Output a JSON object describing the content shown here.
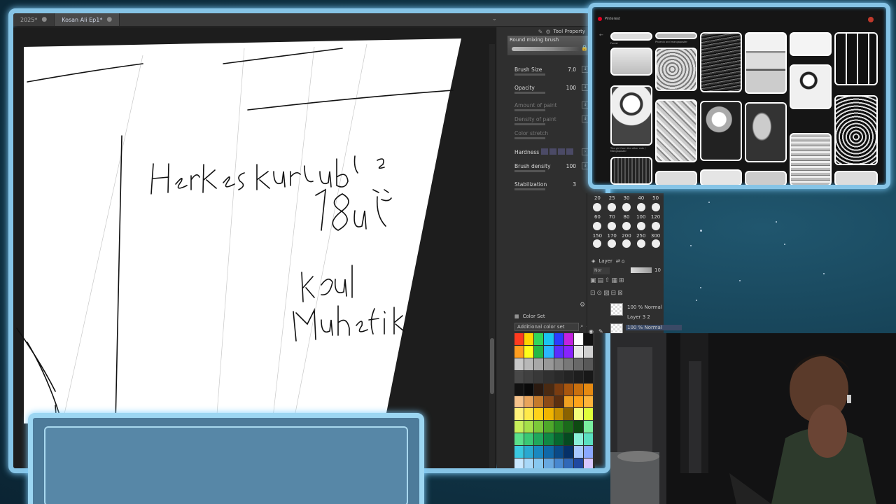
{
  "document_tabs": [
    {
      "label": "2025*",
      "active": false
    },
    {
      "label": "Kosan Ali Ep1*",
      "active": true
    }
  ],
  "tool_property": {
    "header": "Tool Property",
    "brush_name": "Round mixing brush",
    "properties": [
      {
        "label": "Brush Size",
        "value": "7.0",
        "enabled": true
      },
      {
        "label": "Opacity",
        "value": "100",
        "enabled": true
      },
      {
        "label": "Amount of paint",
        "value": "",
        "enabled": false
      },
      {
        "label": "Density of paint",
        "value": "",
        "enabled": false
      },
      {
        "label": "Color stretch",
        "value": "",
        "enabled": false
      },
      {
        "label": "Hardness",
        "value": "",
        "enabled": true
      },
      {
        "label": "Brush density",
        "value": "100",
        "enabled": true
      },
      {
        "label": "Stabilization",
        "value": "3",
        "enabled": true
      }
    ]
  },
  "color_set": {
    "header": "Color Set",
    "selected": "Additional color set",
    "colors": [
      "#ff3b1f",
      "#ffd400",
      "#2fd65c",
      "#19c4f0",
      "#2a3cff",
      "#c322e0",
      "#ffffff",
      "#111111",
      "#ff9e1f",
      "#ffff1a",
      "#23b847",
      "#2ab6ff",
      "#5a2dff",
      "#8822ff",
      "#e8e8e8",
      "#d0d0d0",
      "#c8c8c8",
      "#b8b8b8",
      "#a8a8a8",
      "#989898",
      "#888888",
      "#787878",
      "#686868",
      "#585858",
      "#484848",
      "#404040",
      "#383838",
      "#303030",
      "#2a2a2a",
      "#242424",
      "#1e1e1e",
      "#181818",
      "#111111",
      "#0a0a0a",
      "#2b1a10",
      "#4a2a12",
      "#7a3c10",
      "#a8560e",
      "#c9700e",
      "#e68a12",
      "#f6c38c",
      "#e8a45c",
      "#c47a2c",
      "#8b4a18",
      "#5c2f10",
      "#f0a020",
      "#ffa31a",
      "#ffb43a",
      "#fff27a",
      "#ffe94a",
      "#ffd21a",
      "#f0b400",
      "#c89000",
      "#8a6200",
      "#f4ff7a",
      "#dfff3a",
      "#c8f05a",
      "#a6e04a",
      "#7cc83a",
      "#4ea82a",
      "#2a8a22",
      "#1a6a1a",
      "#0e4a12",
      "#7af0a0",
      "#5ae08a",
      "#3ac874",
      "#20a85c",
      "#108844",
      "#06682e",
      "#054a20",
      "#8af0d8",
      "#5ae0c0",
      "#3ac8e0",
      "#2aa8d0",
      "#1a88c0",
      "#1068a8",
      "#0a4a88",
      "#063068",
      "#a8c8ff",
      "#8aa8ff",
      "#c8e8ff",
      "#a8d8f8",
      "#88c8f0",
      "#68a8e0",
      "#4888d0",
      "#3068b8",
      "#2048a0",
      "#d8c8ff"
    ]
  },
  "brush_size_palette": {
    "row1": [
      "20",
      "25",
      "30",
      "40",
      "50"
    ],
    "row2": [
      "60",
      "70",
      "80",
      "100",
      "120"
    ],
    "row3": [
      "150",
      "170",
      "200",
      "250",
      "300"
    ]
  },
  "layer_panel": {
    "header": "Layer",
    "blend_mode": "Nor",
    "opacity": "10",
    "layers": [
      {
        "label": "100 % Normal",
        "selected": false
      },
      {
        "label": "Layer 3 2",
        "selected": false
      },
      {
        "label": "100 % Normal",
        "selected": true
      }
    ]
  },
  "pinterest": {
    "app_name": "Pinterest",
    "captions": [
      "Forest",
      "Phoenix and mangaposter",
      "The girl from the other side / Mangaposter"
    ]
  },
  "canvas": {
    "handwriting_line1": "Herkes kurtulur",
    "handwriting_line2": "18 ili",
    "handwriting_line3": "Kpul",
    "handwriting_line4": "Muhafiz"
  },
  "icons": {
    "tool_property": "wrench-icon",
    "lock": "lock-icon",
    "eye": "eye-icon",
    "pen": "pen-icon"
  }
}
